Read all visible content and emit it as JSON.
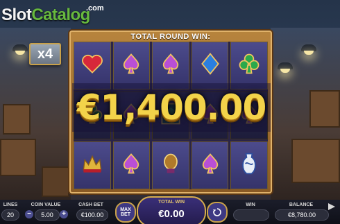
{
  "logo": {
    "part1": "Slot",
    "part2": "Catalog",
    "suffix": ".com"
  },
  "multiplier": "x4",
  "reels": {
    "title": "TOTAL ROUND WIN:",
    "big_win": "€1,400.00",
    "symbols": [
      [
        "heart",
        "spade",
        "spade",
        "diamond",
        "club"
      ],
      [
        "club",
        "spade",
        "lion",
        "spade",
        "spade"
      ],
      [
        "crown",
        "spade",
        "egg",
        "spade",
        "vase"
      ]
    ]
  },
  "controls": {
    "lines_label": "LINES",
    "lines_value": "20",
    "coin_label": "COIN VALUE",
    "coin_value": "5.00",
    "coin_minus": "−",
    "coin_plus": "+",
    "cash_bet_label": "CASH BET",
    "cash_bet_value": "€100.00",
    "max_bet_label": "MAX BET",
    "total_win_label": "TOTAL WIN",
    "total_win_value": "€0.00",
    "win_label": "WIN",
    "win_value": "",
    "balance_label": "BALANCE",
    "balance_value": "€8,780.00"
  },
  "colors": {
    "gold": "#f3d34a",
    "frame": "#b7843d",
    "reel_bg": "#3f3d7a",
    "logo_green": "#67b93e"
  }
}
